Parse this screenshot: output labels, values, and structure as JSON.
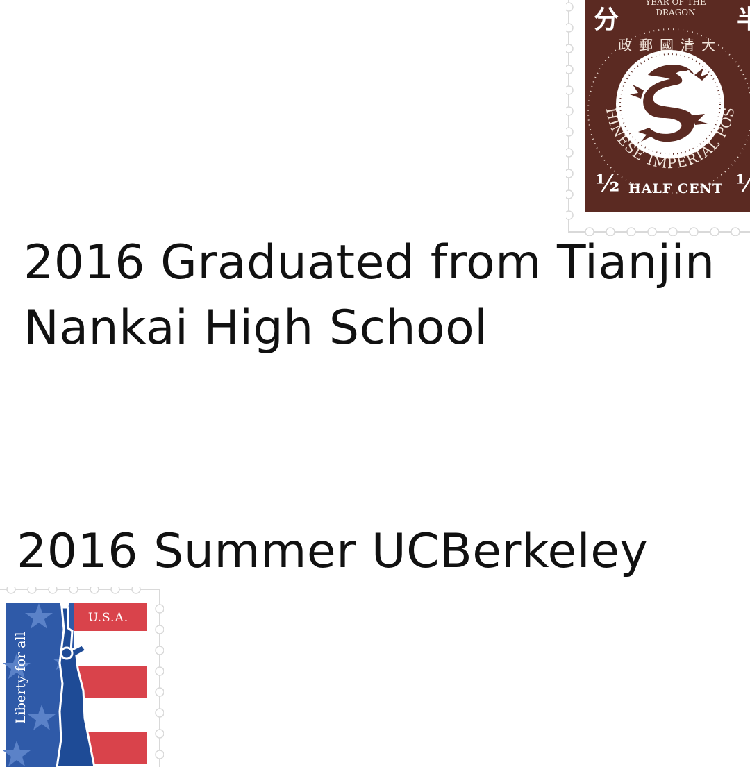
{
  "headlines": {
    "graduation_line1": "2016 Graduated from Tianjin",
    "graduation_line2": "Nankai High School",
    "summer": "2016 Summer UCBerkeley"
  },
  "chinese_stamp": {
    "year_label_line1": "YEAR OF THE",
    "year_label_line2": "DRAGON",
    "left_character": "分",
    "right_character": "半",
    "arc_characters": "政郵國清大",
    "ring_text": "CHINESE IMPERIAL POST",
    "fraction": "½",
    "denomination": "HALF CENT",
    "background_color": "#5b2a22",
    "icon": "dragon-icon"
  },
  "usa_stamp": {
    "country": "U.S.A.",
    "slogan": "Liberty for all",
    "colors": {
      "blue": "#2f5aa8",
      "red": "#d9434b",
      "statue": "#1e4b96"
    },
    "icon": "statue-of-liberty-icon"
  }
}
